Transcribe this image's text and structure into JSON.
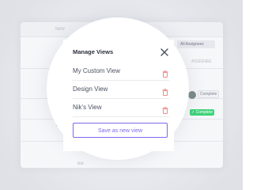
{
  "background": {
    "topbar_left_text": "NEW",
    "topbar_mid_text": "ew",
    "topbar_mid_icon": "chevron-down-icon",
    "assignees_label": "All Assignees",
    "assignee_column": "ASSIGNEE",
    "status_chip": "Complete",
    "status_badge": "✓ Complete",
    "bottom_text": "ew"
  },
  "modal": {
    "title": "Manage Views",
    "close_icon": "close-icon",
    "views": [
      {
        "label": "My Custom View",
        "icon": "trash-icon"
      },
      {
        "label": "Design View",
        "icon": "trash-icon"
      },
      {
        "label": "Nik's View",
        "icon": "trash-icon"
      }
    ],
    "save_label": "Save as new view"
  },
  "colors": {
    "accent": "#7b68ee",
    "trash": "#f08a8a",
    "complete_green": "#3ed37a"
  }
}
